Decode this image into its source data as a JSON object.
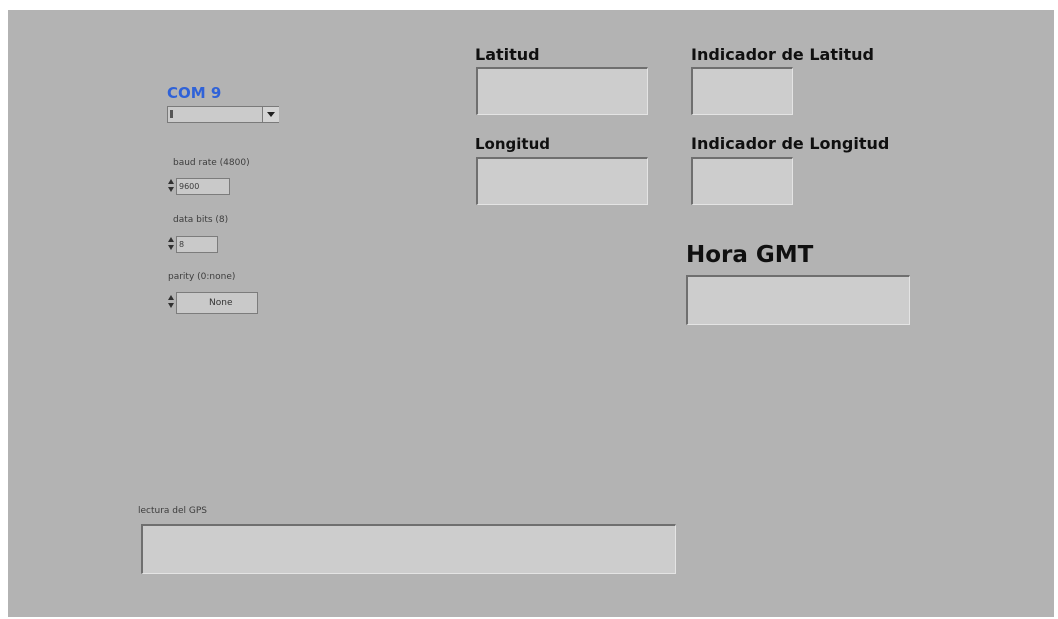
{
  "visa": {
    "resource": "COM 9",
    "value": ""
  },
  "baud_rate": {
    "label": "baud rate (4800)",
    "value": "9600"
  },
  "data_bits": {
    "label": "data bits (8)",
    "value": "8"
  },
  "parity": {
    "label": "parity (0:none)",
    "value": "None"
  },
  "latitud": {
    "label": "Latitud",
    "value": ""
  },
  "longitud": {
    "label": "Longitud",
    "value": ""
  },
  "indicador_latitud": {
    "label": "Indicador de Latitud",
    "value": ""
  },
  "indicador_longitud": {
    "label": "Indicador de Longitud",
    "value": ""
  },
  "hora_gmt": {
    "label": "Hora GMT",
    "value": ""
  },
  "lectura_gps": {
    "label": "lectura del GPS",
    "value": ""
  },
  "colors": {
    "panel": "#b3b3b3",
    "indicator": "#cdcdcd",
    "visa_label": "#2f62d8"
  },
  "icons": [
    "visa-icon",
    "dropdown-arrow-icon",
    "spinner-arrows-icon"
  ]
}
